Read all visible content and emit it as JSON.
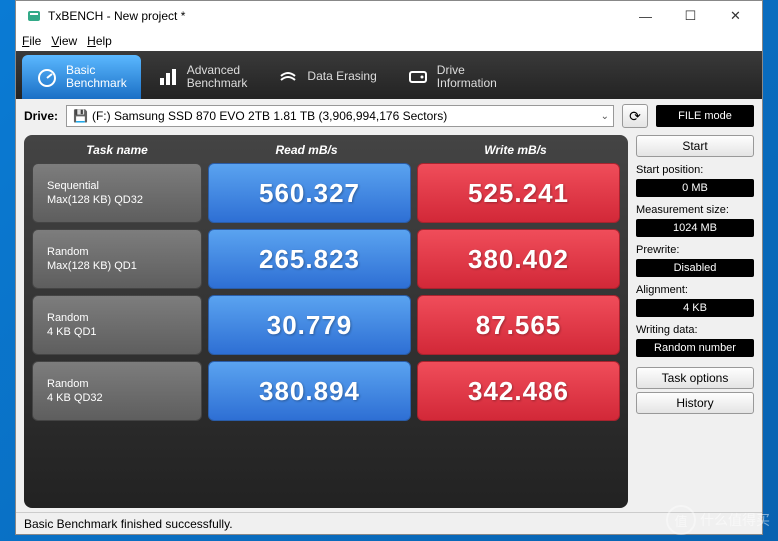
{
  "window": {
    "title": "TxBENCH - New project *"
  },
  "menus": {
    "file": "File",
    "view": "View",
    "help": "Help"
  },
  "tabs": {
    "basic": "Basic\nBenchmark",
    "advanced": "Advanced\nBenchmark",
    "erasing": "Data Erasing",
    "driveinfo": "Drive\nInformation"
  },
  "drive": {
    "label": "Drive:",
    "value": "(F:) Samsung SSD 870 EVO 2TB  1.81 TB (3,906,994,176 Sectors)"
  },
  "filemode": "FILE mode",
  "headers": {
    "task": "Task name",
    "read": "Read mB/s",
    "write": "Write mB/s"
  },
  "rows": [
    {
      "name1": "Sequential",
      "name2": "Max(128 KB) QD32",
      "read": "560.327",
      "write": "525.241"
    },
    {
      "name1": "Random",
      "name2": "Max(128 KB) QD1",
      "read": "265.823",
      "write": "380.402"
    },
    {
      "name1": "Random",
      "name2": "4 KB QD1",
      "read": "30.779",
      "write": "87.565"
    },
    {
      "name1": "Random",
      "name2": "4 KB QD32",
      "read": "380.894",
      "write": "342.486"
    }
  ],
  "sidebar": {
    "start": "Start",
    "startpos_l": "Start position:",
    "startpos_v": "0 MB",
    "msize_l": "Measurement size:",
    "msize_v": "1024 MB",
    "prewrite_l": "Prewrite:",
    "prewrite_v": "Disabled",
    "align_l": "Alignment:",
    "align_v": "4 KB",
    "wdata_l": "Writing data:",
    "wdata_v": "Random number",
    "taskopt": "Task options",
    "history": "History"
  },
  "status": "Basic Benchmark finished successfully.",
  "watermark": {
    "circle": "值",
    "text": "什么值得买"
  },
  "chart_data": {
    "type": "table",
    "title": "TxBENCH Basic Benchmark",
    "columns": [
      "Task name",
      "Read mB/s",
      "Write mB/s"
    ],
    "rows": [
      [
        "Sequential Max(128 KB) QD32",
        560.327,
        525.241
      ],
      [
        "Random Max(128 KB) QD1",
        265.823,
        380.402
      ],
      [
        "Random 4 KB QD1",
        30.779,
        87.565
      ],
      [
        "Random 4 KB QD32",
        380.894,
        342.486
      ]
    ]
  }
}
